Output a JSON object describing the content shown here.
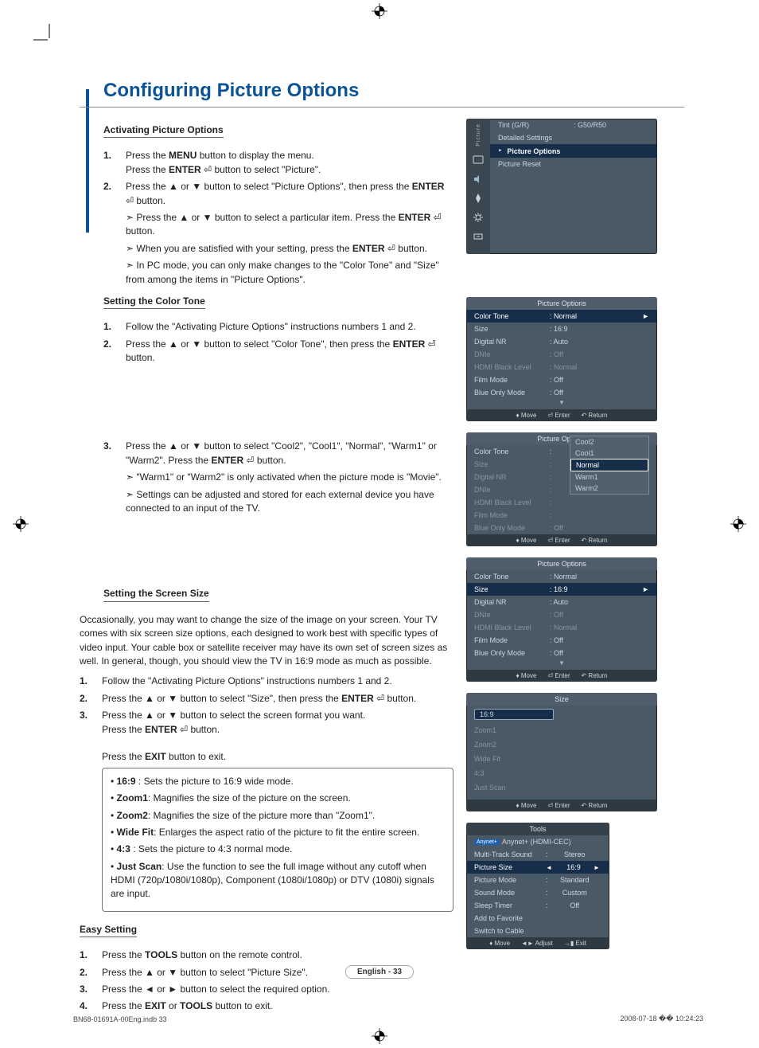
{
  "page_title": "Configuring Picture Options",
  "sections": {
    "activating": {
      "heading": "Activating Picture Options",
      "s1a": "Press the ",
      "s1b": "MENU",
      "s1c": " button to display the menu.",
      "s1d": "Press the ",
      "s1e": "ENTER",
      "s1f": " button to select \"Picture\".",
      "s2a": "Press the ▲ or ▼ button to select \"Picture Options\", then press the ",
      "s2b": "ENTER",
      "s2c": " button.",
      "b1a": "Press the ▲ or ▼ button to select a particular item. Press the ",
      "b1b": "ENTER",
      "b1c": " button.",
      "b2a": "When you are satisfied with your setting, press the ",
      "b2b": "ENTER",
      "b2c": " button.",
      "b3": "In PC mode, you can only make changes to the \"Color Tone\" and \"Size\" from among the items in \"Picture Options\"."
    },
    "color_tone": {
      "heading": "Setting the Color Tone",
      "s1": "Follow the \"Activating Picture Options\" instructions numbers 1 and 2.",
      "s2a": "Press the ▲ or ▼ button to select \"Color Tone\", then press the ",
      "s2b": "ENTER",
      "s2c": " button.",
      "s3a": "Press the ▲ or ▼ button to select \"Cool2\", \"Cool1\", \"Normal\", \"Warm1\" or \"Warm2\". Press the ",
      "s3b": "ENTER",
      "s3c": " button.",
      "b1": "\"Warm1\" or \"Warm2\" is only activated when the picture mode is \"Movie\".",
      "b2": "Settings can be adjusted and stored for each external device you have connected to an input of the TV."
    },
    "screen_size": {
      "heading": "Setting the Screen Size",
      "intro": "Occasionally, you may want to change the size of the image on your screen. Your TV comes with six screen size options, each designed to work best with specific types of video input. Your cable box or satellite receiver may have its own set of screen sizes as well. In general, though, you should view the TV in 16:9 mode as much as possible.",
      "s1": "Follow the \"Activating Picture Options\" instructions numbers 1 and 2.",
      "s2a": "Press the ▲ or ▼ button to select \"Size\", then press the ",
      "s2b": "ENTER",
      "s2c": " button.",
      "s3a": "Press the ▲ or ▼ button to select the screen format you want.",
      "s3b": "Press the ",
      "s3c": "ENTER",
      "s3d": " button.",
      "s3e": "Press the ",
      "s3f": "EXIT",
      "s3g": " button to exit.",
      "opts": {
        "o1b": "16:9",
        "o1": " : Sets the picture to 16:9 wide mode.",
        "o2b": "Zoom1",
        "o2": ": Magnifies the size of the picture on the screen.",
        "o3b": "Zoom2",
        "o3": ": Magnifies the size of the picture more than \"Zoom1\".",
        "o4b": "Wide Fit",
        "o4": ": Enlarges the aspect ratio of the picture to fit the entire screen.",
        "o5b": "4:3",
        "o5": " : Sets the picture to 4:3 normal mode.",
        "o6b": "Just Scan",
        "o6": ": Use the function to see the full image without any cutoff when HDMI (720p/1080i/1080p), Component (1080i/1080p) or DTV (1080i) signals are input."
      }
    },
    "easy": {
      "heading": "Easy Setting",
      "s1a": "Press the ",
      "s1b": "TOOLS",
      "s1c": " button on the remote control.",
      "s2": "Press the ▲ or ▼ button to select \"Picture Size\".",
      "s3": "Press the ◄ or ► button to select the required option.",
      "s4a": "Press the ",
      "s4b": "EXIT",
      "s4c": " or ",
      "s4d": "TOOLS",
      "s4e": " button to exit."
    }
  },
  "osd1": {
    "side_label": "Picture",
    "r1_l": "Tint (G/R)",
    "r1_v": ": G50/R50",
    "r2_l": "Detailed Settings",
    "r3_l": "Picture Options",
    "r4_l": "Picture Reset"
  },
  "osd_po": {
    "title": "Picture Options",
    "r1_l": "Color Tone",
    "r1_v": ": Normal",
    "r2_l": "Size",
    "r2_v": ": 16:9",
    "r3_l": "Digital NR",
    "r3_v": ": Auto",
    "r4_l": "DNIe",
    "r4_v": ": Off",
    "r5_l": "HDMI Black Level",
    "r5_v": ": Normal",
    "r6_l": "Film Mode",
    "r6_v": ": Off",
    "r7_l": "Blue Only Mode",
    "r7_v": ": Off"
  },
  "osd_ct_opts": {
    "o1": "Cool2",
    "o2": "Cool1",
    "o3": "Normal",
    "o4": "Warm1",
    "o5": "Warm2"
  },
  "osd_size": {
    "title": "Size",
    "o1": "16:9",
    "o2": "Zoom1",
    "o3": "Zoom2",
    "o4": "Wide Fit",
    "o5": "4:3",
    "o6": "Just Scan"
  },
  "osd_tools": {
    "title": "Tools",
    "r1_l": "Anynet+ (HDMI-CEC)",
    "r2_l": "Multi-Track Sound",
    "r2_v": "Stereo",
    "r3_l": "Picture Size",
    "r3_v": "16:9",
    "r4_l": "Picture Mode",
    "r4_v": "Standard",
    "r5_l": "Sound Mode",
    "r5_v": "Custom",
    "r6_l": "Sleep Timer",
    "r6_v": "Off",
    "r7_l": "Add to Favorite",
    "r8_l": "Switch to Cable"
  },
  "hints": {
    "move": "Move",
    "enter": "Enter",
    "return": "Return",
    "adjust": "Adjust",
    "exit": "Exit"
  },
  "footer": {
    "pagelabel": "English - 33",
    "left": "BN68-01691A-00Eng.indb   33",
    "right": "2008-07-18   �� 10:24:23"
  }
}
